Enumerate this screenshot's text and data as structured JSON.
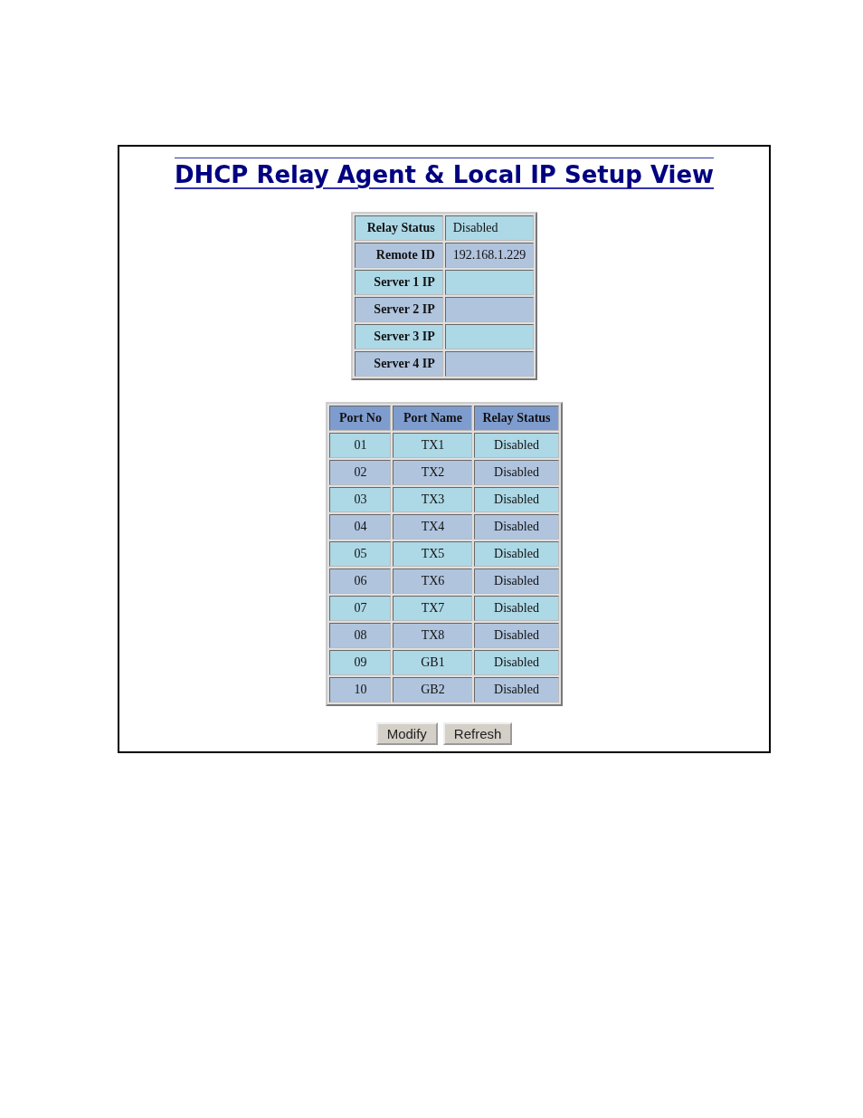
{
  "title": "DHCP Relay Agent & Local IP Setup View",
  "settings": [
    {
      "label": "Relay Status",
      "value": "Disabled"
    },
    {
      "label": "Remote ID",
      "value": "192.168.1.229"
    },
    {
      "label": "Server 1 IP"
    },
    {
      "label": "Server 2 IP"
    },
    {
      "label": "Server 3 IP"
    },
    {
      "label": "Server 4 IP"
    }
  ],
  "ports": {
    "columns": [
      "Port No",
      "Port Name",
      "Relay Status"
    ],
    "rows": [
      [
        "01",
        "TX1",
        "Disabled"
      ],
      [
        "02",
        "TX2",
        "Disabled"
      ],
      [
        "03",
        "TX3",
        "Disabled"
      ],
      [
        "04",
        "TX4",
        "Disabled"
      ],
      [
        "05",
        "TX5",
        "Disabled"
      ],
      [
        "06",
        "TX6",
        "Disabled"
      ],
      [
        "07",
        "TX7",
        "Disabled"
      ],
      [
        "08",
        "TX8",
        "Disabled"
      ],
      [
        "09",
        "GB1",
        "Disabled"
      ],
      [
        "10",
        "GB2",
        "Disabled"
      ]
    ]
  },
  "buttons": [
    "Modify",
    "Refresh"
  ]
}
